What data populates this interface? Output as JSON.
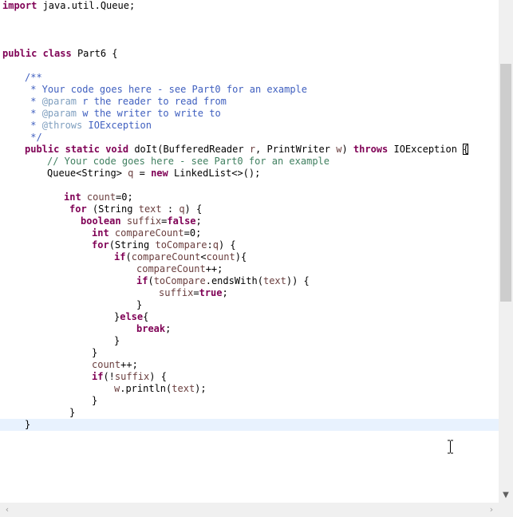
{
  "editor": {
    "lines": [
      {
        "indent": 0,
        "tokens": [
          {
            "t": "import",
            "c": "kw"
          },
          {
            "t": " java.util.Queue;"
          }
        ]
      },
      {
        "indent": 0,
        "tokens": []
      },
      {
        "indent": 0,
        "tokens": []
      },
      {
        "indent": 0,
        "tokens": []
      },
      {
        "indent": 0,
        "tokens": [
          {
            "t": "public",
            "c": "kw"
          },
          {
            "t": " "
          },
          {
            "t": "class",
            "c": "kw"
          },
          {
            "t": " Part6 {"
          }
        ]
      },
      {
        "indent": 0,
        "tokens": []
      },
      {
        "indent": 4,
        "tokens": [
          {
            "t": "/**",
            "c": "jd"
          }
        ]
      },
      {
        "indent": 4,
        "tokens": [
          {
            "t": " * Your code goes here - see Part0 for an example",
            "c": "jd"
          }
        ]
      },
      {
        "indent": 4,
        "tokens": [
          {
            "t": " * ",
            "c": "jd"
          },
          {
            "t": "@param",
            "c": "tag"
          },
          {
            "t": " r the reader to read from",
            "c": "jd"
          }
        ]
      },
      {
        "indent": 4,
        "tokens": [
          {
            "t": " * ",
            "c": "jd"
          },
          {
            "t": "@param",
            "c": "tag"
          },
          {
            "t": " w the writer to write to",
            "c": "jd"
          }
        ]
      },
      {
        "indent": 4,
        "tokens": [
          {
            "t": " * ",
            "c": "jd"
          },
          {
            "t": "@throws",
            "c": "tag"
          },
          {
            "t": " IOException",
            "c": "jd"
          }
        ]
      },
      {
        "indent": 4,
        "tokens": [
          {
            "t": " */",
            "c": "jd"
          }
        ]
      },
      {
        "indent": 4,
        "tokens": [
          {
            "t": "public",
            "c": "kw"
          },
          {
            "t": " "
          },
          {
            "t": "static",
            "c": "kw"
          },
          {
            "t": " "
          },
          {
            "t": "void",
            "c": "kw"
          },
          {
            "t": " doIt(BufferedReader "
          },
          {
            "t": "r",
            "c": "vr"
          },
          {
            "t": ", PrintWriter "
          },
          {
            "t": "w",
            "c": "vr"
          },
          {
            "t": ") "
          },
          {
            "t": "throws",
            "c": "kw"
          },
          {
            "t": " IOException "
          },
          {
            "t": "{",
            "c": "bracket"
          }
        ]
      },
      {
        "indent": 8,
        "tokens": [
          {
            "t": "// Your code goes here - see Part0 for an example",
            "c": "cm"
          }
        ]
      },
      {
        "indent": 8,
        "tokens": [
          {
            "t": "Queue<String> "
          },
          {
            "t": "q",
            "c": "vr"
          },
          {
            "t": " = "
          },
          {
            "t": "new",
            "c": "kw"
          },
          {
            "t": " LinkedList<>();"
          }
        ]
      },
      {
        "indent": 0,
        "tokens": []
      },
      {
        "indent": 11,
        "tokens": [
          {
            "t": "int",
            "c": "kw"
          },
          {
            "t": " "
          },
          {
            "t": "count",
            "c": "vr"
          },
          {
            "t": "=0;"
          }
        ]
      },
      {
        "indent": 12,
        "tokens": [
          {
            "t": "for",
            "c": "kw"
          },
          {
            "t": " (String "
          },
          {
            "t": "text",
            "c": "vr"
          },
          {
            "t": " : "
          },
          {
            "t": "q",
            "c": "vr"
          },
          {
            "t": ") {"
          }
        ]
      },
      {
        "indent": 14,
        "tokens": [
          {
            "t": "boolean",
            "c": "kw"
          },
          {
            "t": " "
          },
          {
            "t": "suffix",
            "c": "vr"
          },
          {
            "t": "="
          },
          {
            "t": "false",
            "c": "kw"
          },
          {
            "t": ";"
          }
        ]
      },
      {
        "indent": 16,
        "tokens": [
          {
            "t": "int",
            "c": "kw"
          },
          {
            "t": " "
          },
          {
            "t": "compareCount",
            "c": "vr"
          },
          {
            "t": "=0;"
          }
        ]
      },
      {
        "indent": 16,
        "tokens": [
          {
            "t": "for",
            "c": "kw"
          },
          {
            "t": "(String "
          },
          {
            "t": "toCompare",
            "c": "vr"
          },
          {
            "t": ":"
          },
          {
            "t": "q",
            "c": "vr"
          },
          {
            "t": ") {"
          }
        ]
      },
      {
        "indent": 20,
        "tokens": [
          {
            "t": "if",
            "c": "kw"
          },
          {
            "t": "("
          },
          {
            "t": "compareCount",
            "c": "vr"
          },
          {
            "t": "<"
          },
          {
            "t": "count",
            "c": "vr"
          },
          {
            "t": "){"
          }
        ]
      },
      {
        "indent": 24,
        "tokens": [
          {
            "t": "compareCount",
            "c": "vr"
          },
          {
            "t": "++;"
          }
        ]
      },
      {
        "indent": 24,
        "tokens": [
          {
            "t": "if",
            "c": "kw"
          },
          {
            "t": "("
          },
          {
            "t": "toCompare",
            "c": "vr"
          },
          {
            "t": ".endsWith("
          },
          {
            "t": "text",
            "c": "vr"
          },
          {
            "t": ")) {"
          }
        ]
      },
      {
        "indent": 28,
        "tokens": [
          {
            "t": "suffix",
            "c": "vr"
          },
          {
            "t": "="
          },
          {
            "t": "true",
            "c": "kw"
          },
          {
            "t": ";"
          }
        ]
      },
      {
        "indent": 24,
        "tokens": [
          {
            "t": "}"
          }
        ]
      },
      {
        "indent": 20,
        "tokens": [
          {
            "t": "}"
          },
          {
            "t": "else",
            "c": "kw"
          },
          {
            "t": "{"
          }
        ]
      },
      {
        "indent": 24,
        "tokens": [
          {
            "t": "break",
            "c": "kw"
          },
          {
            "t": ";"
          }
        ]
      },
      {
        "indent": 20,
        "tokens": [
          {
            "t": "}"
          }
        ]
      },
      {
        "indent": 16,
        "tokens": [
          {
            "t": "}"
          }
        ]
      },
      {
        "indent": 16,
        "tokens": [
          {
            "t": "count",
            "c": "vr"
          },
          {
            "t": "++;"
          }
        ]
      },
      {
        "indent": 16,
        "tokens": [
          {
            "t": "if",
            "c": "kw"
          },
          {
            "t": "(!"
          },
          {
            "t": "suffix",
            "c": "vr"
          },
          {
            "t": ") {"
          }
        ]
      },
      {
        "indent": 20,
        "tokens": [
          {
            "t": "w",
            "c": "vr"
          },
          {
            "t": ".println("
          },
          {
            "t": "text",
            "c": "vr"
          },
          {
            "t": ");"
          }
        ]
      },
      {
        "indent": 16,
        "tokens": [
          {
            "t": "}"
          }
        ]
      },
      {
        "indent": 12,
        "tokens": [
          {
            "t": "}"
          }
        ]
      },
      {
        "indent": 4,
        "tokens": [
          {
            "t": "}"
          }
        ],
        "current": true
      }
    ]
  },
  "scrollbars": {
    "vertical_thumb_fraction": 0.47,
    "vertical_position_fraction": 0.13
  },
  "icons": {
    "scroll_down": "chevron-down-icon",
    "scroll_left": "chevron-left-icon",
    "scroll_right": "chevron-right-icon",
    "cursor": "text-cursor-icon"
  }
}
